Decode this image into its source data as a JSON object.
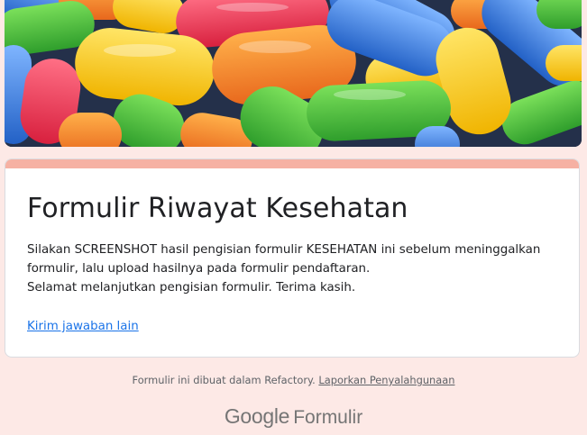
{
  "banner": {
    "description_icon": "colorful-capsule-candies-image"
  },
  "form": {
    "title": "Formulir Riwayat Kesehatan",
    "description_line1": "Silakan SCREENSHOT hasil pengisian formulir KESEHATAN ini sebelum meninggalkan formulir, lalu upload hasilnya pada formulir pendaftaran.",
    "description_line2": "Selamat melanjutkan pengisian formulir. Terima kasih.",
    "resubmit_link": "Kirim jawaban lain"
  },
  "footer": {
    "note_text": "Formulir ini dibuat dalam Refactory. ",
    "abuse_link": "Laporkan Penyalahgunaan",
    "brand_google": "Google",
    "brand_product": "Formulir"
  },
  "colors": {
    "page_background": "#fde9e6",
    "card_accent": "#f6b1a3",
    "link": "#1a73e8",
    "text": "#202124",
    "muted_text": "#5f6368"
  }
}
